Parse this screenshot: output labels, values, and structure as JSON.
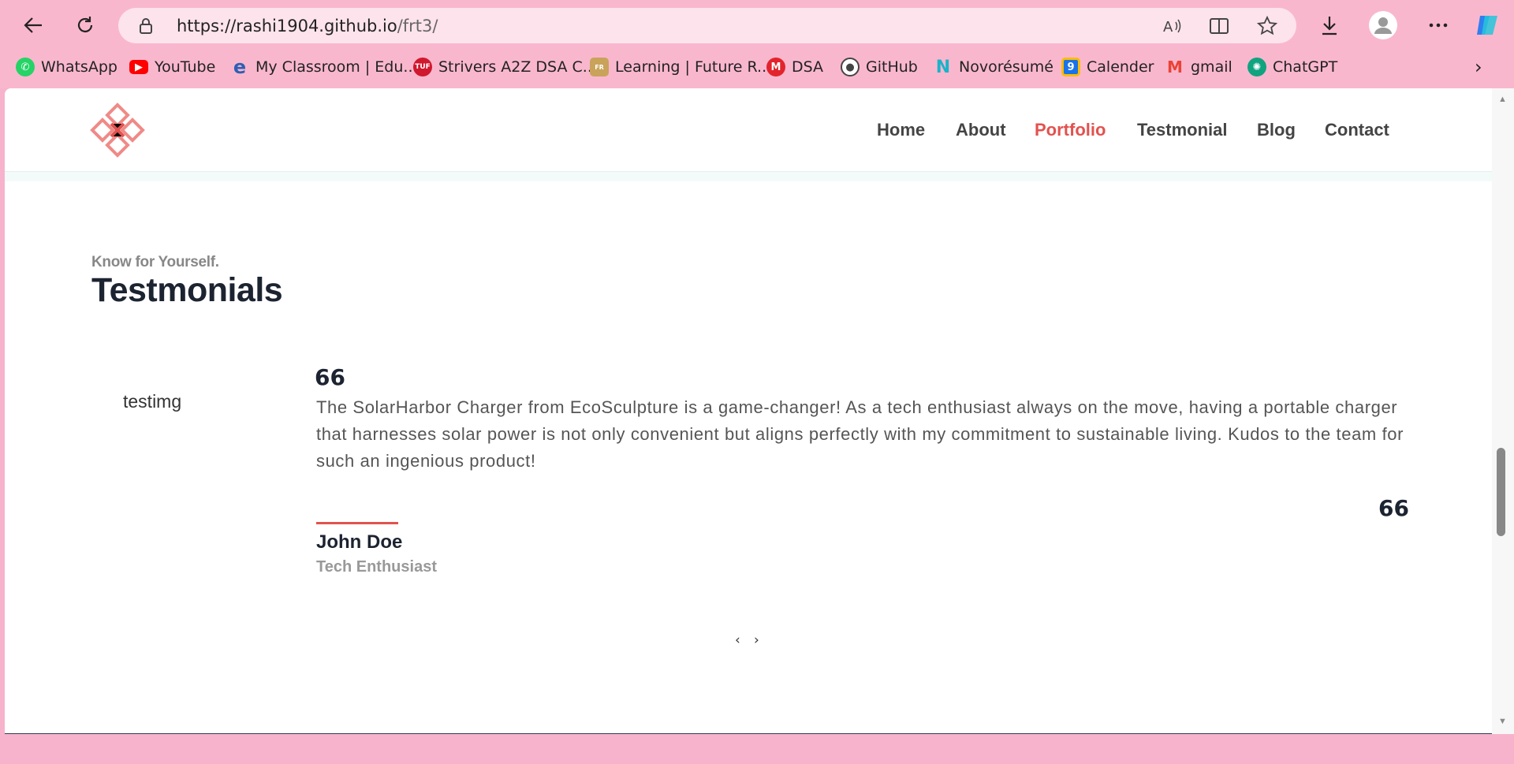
{
  "browser": {
    "url_host": "https://rashi1904.github.io",
    "url_path": "/frt3/",
    "bookmarks": [
      {
        "label": "WhatsApp",
        "icon": "whatsapp-icon",
        "color": "#25d366"
      },
      {
        "label": "YouTube",
        "icon": "youtube-icon",
        "color": "#ff0000"
      },
      {
        "label": "My Classroom | Edu...",
        "icon": "classroom-icon",
        "color": "#2f5fb3"
      },
      {
        "label": "Strivers A2Z DSA C...",
        "icon": "striver-icon",
        "color": "#d0182e"
      },
      {
        "label": "Learning | Future R...",
        "icon": "learning-icon",
        "color": "#7a5b2e"
      },
      {
        "label": "DSA",
        "icon": "dsa-icon",
        "color": "#e3232c"
      },
      {
        "label": "GitHub",
        "icon": "github-icon",
        "color": "#444444"
      },
      {
        "label": "Novorésumé",
        "icon": "novoresume-icon",
        "color": "#1bb3c9"
      },
      {
        "label": "Calender",
        "icon": "calendar-icon",
        "color": "#1a73e8"
      },
      {
        "label": "gmail",
        "icon": "gmail-icon",
        "color": "#ea4335"
      },
      {
        "label": "ChatGPT",
        "icon": "chatgpt-icon",
        "color": "#10a37f"
      }
    ]
  },
  "nav": {
    "items": [
      "Home",
      "About",
      "Portfolio",
      "Testmonial",
      "Blog",
      "Contact"
    ],
    "active": "Portfolio"
  },
  "section": {
    "kicker": "Know for Yourself.",
    "title": "Testmonials"
  },
  "testimonial": {
    "image_alt": "testimg",
    "quote_mark": "66",
    "quote_mark_2": "66",
    "text": "The SolarHarbor Charger from EcoSculpture is a game-changer! As a tech enthusiast always on the move, having a portable charger that harnesses solar power is not only convenient but aligns perfectly with my commitment to sustainable living. Kudos to the team for such an ingenious product!",
    "author": "John Doe",
    "role": "Tech Enthusiast"
  },
  "slider": {
    "prev": "‹",
    "next": "›"
  },
  "colors": {
    "accent": "#e2524f",
    "heading": "#1c2331",
    "footer": "#2c3e50",
    "chrome": "#f9b7ce"
  }
}
